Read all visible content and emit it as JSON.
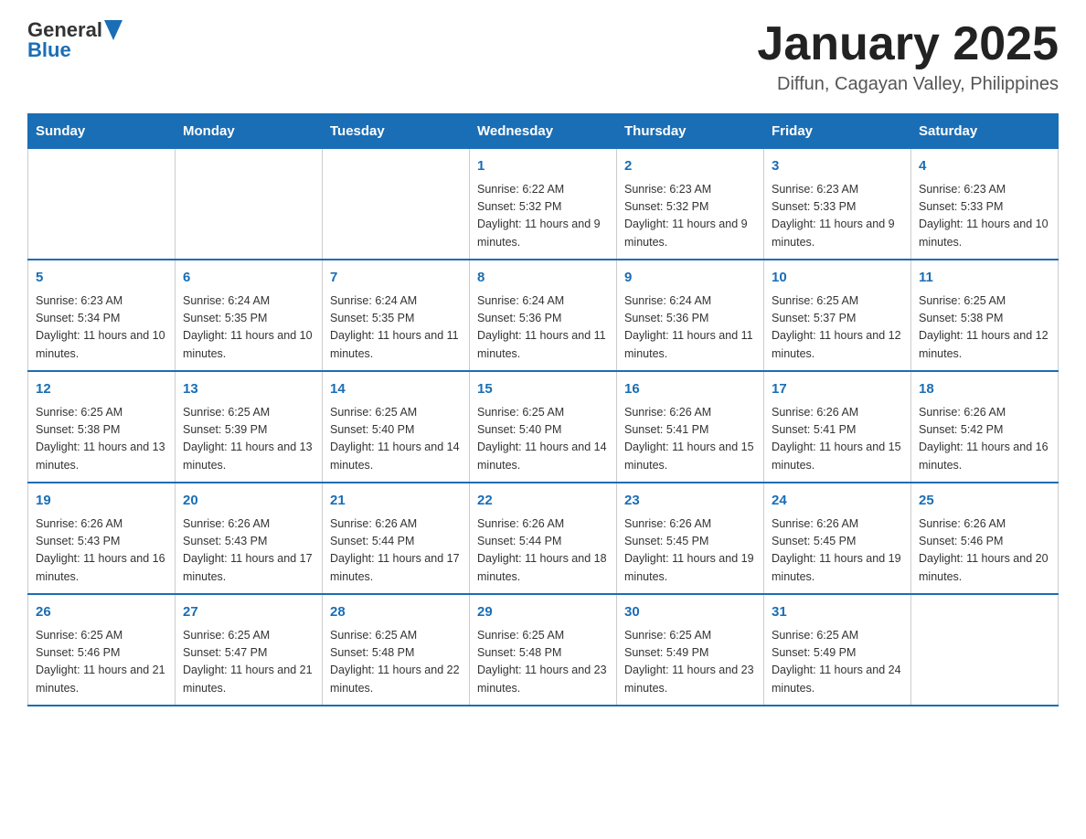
{
  "header": {
    "logo_general": "General",
    "logo_blue": "Blue",
    "title": "January 2025",
    "subtitle": "Diffun, Cagayan Valley, Philippines"
  },
  "days_of_week": [
    "Sunday",
    "Monday",
    "Tuesday",
    "Wednesday",
    "Thursday",
    "Friday",
    "Saturday"
  ],
  "weeks": [
    [
      {
        "day": "",
        "info": ""
      },
      {
        "day": "",
        "info": ""
      },
      {
        "day": "",
        "info": ""
      },
      {
        "day": "1",
        "info": "Sunrise: 6:22 AM\nSunset: 5:32 PM\nDaylight: 11 hours and 9 minutes."
      },
      {
        "day": "2",
        "info": "Sunrise: 6:23 AM\nSunset: 5:32 PM\nDaylight: 11 hours and 9 minutes."
      },
      {
        "day": "3",
        "info": "Sunrise: 6:23 AM\nSunset: 5:33 PM\nDaylight: 11 hours and 9 minutes."
      },
      {
        "day": "4",
        "info": "Sunrise: 6:23 AM\nSunset: 5:33 PM\nDaylight: 11 hours and 10 minutes."
      }
    ],
    [
      {
        "day": "5",
        "info": "Sunrise: 6:23 AM\nSunset: 5:34 PM\nDaylight: 11 hours and 10 minutes."
      },
      {
        "day": "6",
        "info": "Sunrise: 6:24 AM\nSunset: 5:35 PM\nDaylight: 11 hours and 10 minutes."
      },
      {
        "day": "7",
        "info": "Sunrise: 6:24 AM\nSunset: 5:35 PM\nDaylight: 11 hours and 11 minutes."
      },
      {
        "day": "8",
        "info": "Sunrise: 6:24 AM\nSunset: 5:36 PM\nDaylight: 11 hours and 11 minutes."
      },
      {
        "day": "9",
        "info": "Sunrise: 6:24 AM\nSunset: 5:36 PM\nDaylight: 11 hours and 11 minutes."
      },
      {
        "day": "10",
        "info": "Sunrise: 6:25 AM\nSunset: 5:37 PM\nDaylight: 11 hours and 12 minutes."
      },
      {
        "day": "11",
        "info": "Sunrise: 6:25 AM\nSunset: 5:38 PM\nDaylight: 11 hours and 12 minutes."
      }
    ],
    [
      {
        "day": "12",
        "info": "Sunrise: 6:25 AM\nSunset: 5:38 PM\nDaylight: 11 hours and 13 minutes."
      },
      {
        "day": "13",
        "info": "Sunrise: 6:25 AM\nSunset: 5:39 PM\nDaylight: 11 hours and 13 minutes."
      },
      {
        "day": "14",
        "info": "Sunrise: 6:25 AM\nSunset: 5:40 PM\nDaylight: 11 hours and 14 minutes."
      },
      {
        "day": "15",
        "info": "Sunrise: 6:25 AM\nSunset: 5:40 PM\nDaylight: 11 hours and 14 minutes."
      },
      {
        "day": "16",
        "info": "Sunrise: 6:26 AM\nSunset: 5:41 PM\nDaylight: 11 hours and 15 minutes."
      },
      {
        "day": "17",
        "info": "Sunrise: 6:26 AM\nSunset: 5:41 PM\nDaylight: 11 hours and 15 minutes."
      },
      {
        "day": "18",
        "info": "Sunrise: 6:26 AM\nSunset: 5:42 PM\nDaylight: 11 hours and 16 minutes."
      }
    ],
    [
      {
        "day": "19",
        "info": "Sunrise: 6:26 AM\nSunset: 5:43 PM\nDaylight: 11 hours and 16 minutes."
      },
      {
        "day": "20",
        "info": "Sunrise: 6:26 AM\nSunset: 5:43 PM\nDaylight: 11 hours and 17 minutes."
      },
      {
        "day": "21",
        "info": "Sunrise: 6:26 AM\nSunset: 5:44 PM\nDaylight: 11 hours and 17 minutes."
      },
      {
        "day": "22",
        "info": "Sunrise: 6:26 AM\nSunset: 5:44 PM\nDaylight: 11 hours and 18 minutes."
      },
      {
        "day": "23",
        "info": "Sunrise: 6:26 AM\nSunset: 5:45 PM\nDaylight: 11 hours and 19 minutes."
      },
      {
        "day": "24",
        "info": "Sunrise: 6:26 AM\nSunset: 5:45 PM\nDaylight: 11 hours and 19 minutes."
      },
      {
        "day": "25",
        "info": "Sunrise: 6:26 AM\nSunset: 5:46 PM\nDaylight: 11 hours and 20 minutes."
      }
    ],
    [
      {
        "day": "26",
        "info": "Sunrise: 6:25 AM\nSunset: 5:46 PM\nDaylight: 11 hours and 21 minutes."
      },
      {
        "day": "27",
        "info": "Sunrise: 6:25 AM\nSunset: 5:47 PM\nDaylight: 11 hours and 21 minutes."
      },
      {
        "day": "28",
        "info": "Sunrise: 6:25 AM\nSunset: 5:48 PM\nDaylight: 11 hours and 22 minutes."
      },
      {
        "day": "29",
        "info": "Sunrise: 6:25 AM\nSunset: 5:48 PM\nDaylight: 11 hours and 23 minutes."
      },
      {
        "day": "30",
        "info": "Sunrise: 6:25 AM\nSunset: 5:49 PM\nDaylight: 11 hours and 23 minutes."
      },
      {
        "day": "31",
        "info": "Sunrise: 6:25 AM\nSunset: 5:49 PM\nDaylight: 11 hours and 24 minutes."
      },
      {
        "day": "",
        "info": ""
      }
    ]
  ]
}
